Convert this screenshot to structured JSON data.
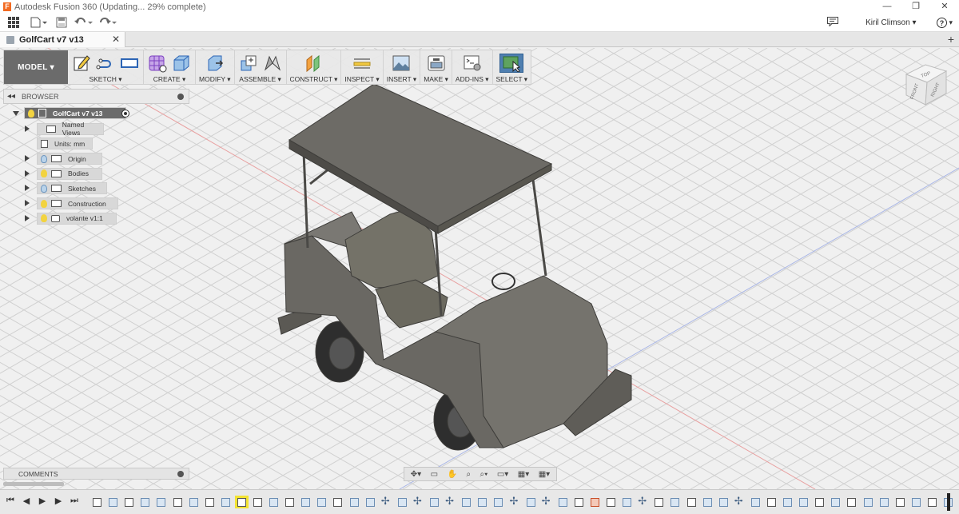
{
  "window": {
    "title": "Autodesk Fusion 360  (Updating... 29% complete)",
    "controls": [
      "—",
      "❐",
      "✕"
    ]
  },
  "qab": {
    "user_name": "Kiril Climson ▾",
    "help_label": "?▾"
  },
  "doc_tab": {
    "name": "GolfCart v7 v13",
    "close": "✕",
    "new": "+"
  },
  "toolbar": {
    "workspace": "MODEL ▾",
    "groups": [
      {
        "label": "SKETCH ▾"
      },
      {
        "label": "CREATE ▾"
      },
      {
        "label": "MODIFY ▾"
      },
      {
        "label": "ASSEMBLE ▾"
      },
      {
        "label": "CONSTRUCT ▾"
      },
      {
        "label": "INSPECT ▾"
      },
      {
        "label": "INSERT ▾"
      },
      {
        "label": "MAKE ▾"
      },
      {
        "label": "ADD-INS ▾"
      },
      {
        "label": "SELECT ▾"
      }
    ]
  },
  "browser": {
    "title": "BROWSER",
    "collapse": "◂◂",
    "root": "GolfCart v7 v13",
    "items": [
      {
        "label": "Named Views"
      },
      {
        "label": "Units: mm"
      },
      {
        "label": "Origin"
      },
      {
        "label": "Bodies"
      },
      {
        "label": "Sketches"
      },
      {
        "label": "Construction"
      },
      {
        "label": "volante v1:1"
      }
    ]
  },
  "viewcube": {
    "top": "TOP",
    "front": "FRONT",
    "right": "RIGHT"
  },
  "comments": {
    "title": "COMMENTS"
  },
  "navbar": {
    "orbit": "✥▾",
    "look": "▭",
    "pan": "✋",
    "zoom_fit": "⌕",
    "zoom": "⌕▾",
    "display": "▭▾",
    "grid": "▦▾",
    "viewports": "▦▾"
  },
  "timeline": {
    "controls": [
      "⏮",
      "◀",
      "▶",
      "▶",
      "⏭"
    ]
  },
  "colors": {
    "model_button": "#6b6b6b",
    "select_button": "#4f7fb0",
    "grid_line": "#cfcfcf",
    "axis_red": "#e8a0a0",
    "axis_blue": "#a9b6e6",
    "cart_body": "#6e6c66",
    "timeline_highlight": "#f3e332"
  }
}
